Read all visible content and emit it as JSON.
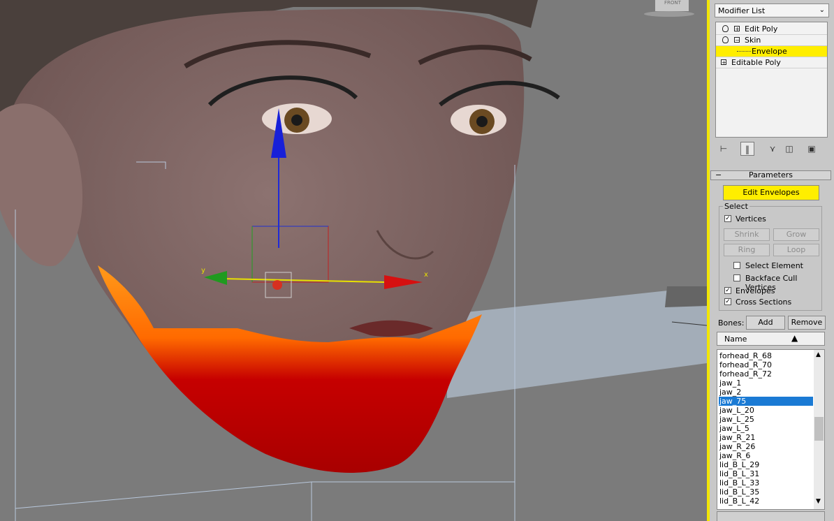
{
  "viewport": {
    "gizmo": {
      "x_label": "x",
      "y_label": "y"
    },
    "viewcube_label": "FRONT"
  },
  "panel": {
    "modifier_list": {
      "value": "Modifier List"
    },
    "stack": [
      {
        "label": "Edit Poly"
      },
      {
        "label": "Skin"
      },
      {
        "label": "Envelope"
      },
      {
        "label": "Editable Poly"
      }
    ],
    "parameters": {
      "title": "Parameters",
      "edit_envelopes": "Edit Envelopes",
      "select": {
        "title": "Select",
        "vertices": {
          "label": "Vertices",
          "checked": true
        },
        "shrink": "Shrink",
        "grow": "Grow",
        "ring": "Ring",
        "loop": "Loop",
        "select_element": {
          "label": "Select Element",
          "checked": false
        },
        "backface": {
          "label": "Backface Cull Vertices",
          "checked": false
        },
        "envelopes": {
          "label": "Envelopes",
          "checked": true
        },
        "cross_sections": {
          "label": "Cross Sections",
          "checked": true
        }
      },
      "bones_label": "Bones:",
      "add": "Add",
      "remove": "Remove",
      "name_header": "Name",
      "bones": [
        "forhead_R_68",
        "forhead_R_70",
        "forhead_R_72",
        "jaw_1",
        "jaw_2",
        "jaw_75",
        "jaw_L_20",
        "jaw_L_25",
        "jaw_L_5",
        "jaw_R_21",
        "jaw_R_26",
        "jaw_R_6",
        "lid_B_L_29",
        "lid_B_L_31",
        "lid_B_L_33",
        "lid_B_L_35",
        "lid_B_L_42"
      ],
      "selected_bone": "jaw_75"
    }
  },
  "colors": {
    "highlight": "#ffee00",
    "selection": "#1a7ad4"
  }
}
